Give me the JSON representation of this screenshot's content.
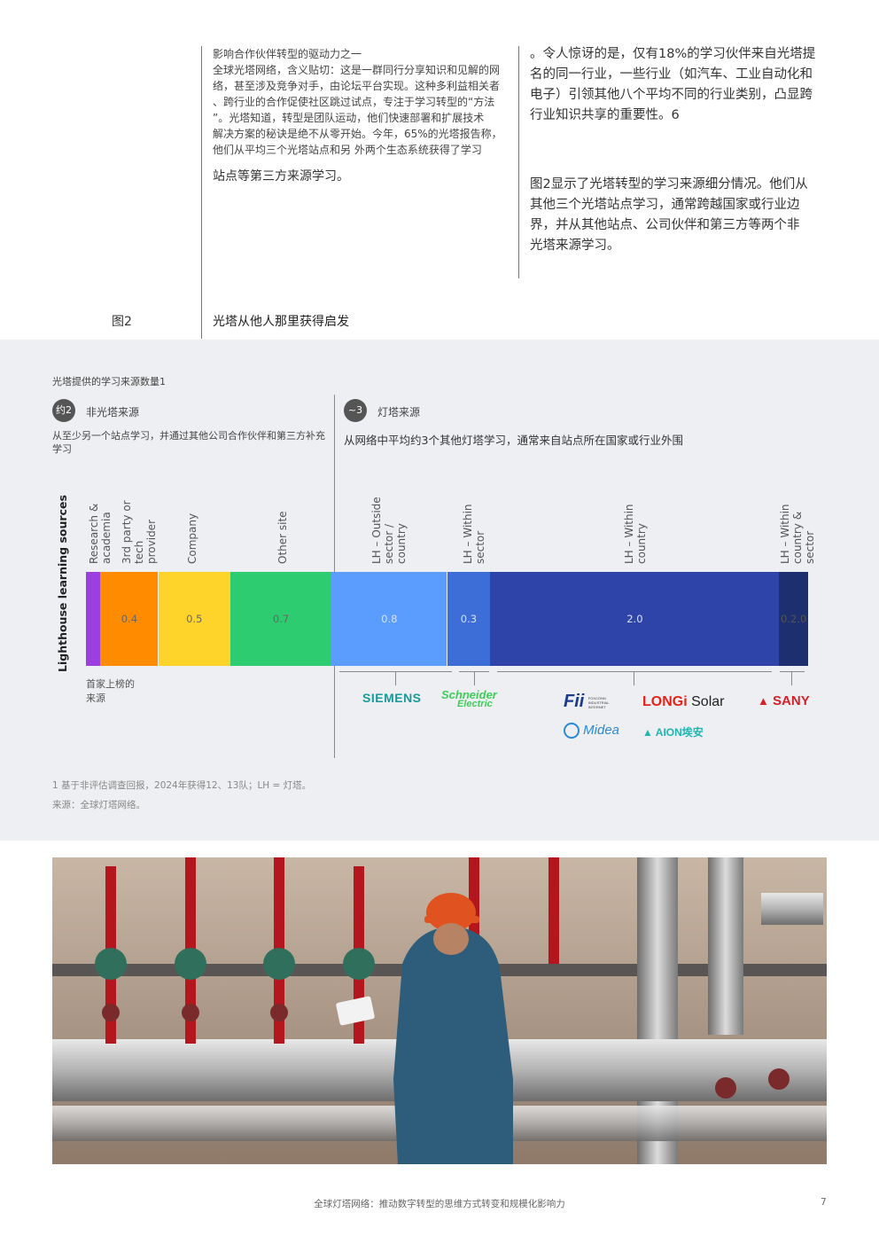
{
  "text": {
    "left_col": {
      "heading": "影响合作伙伴转型的驱动力之一",
      "line1": "全球光塔网络，含义贴切：这是一群同行分享知识和见解的网",
      "line2": "络，甚至涉及竞争对手，由论坛平台实现。这种多利益相关者",
      "line3": "、跨行业的合作促使社区跳过试点，专注于学习转型的“方法",
      "line4": "”。光塔知道，转型是团队运动，他们快速部署和扩展技术",
      "line5": "解决方案的秘诀是绝不从零开始。今年，65%的光塔报告称，",
      "line6": "他们从平均三个光塔站点和另 外两个生态系统获得了学习",
      "line7": "站点等第三方来源学习。"
    },
    "right_col": {
      "line1": "。令人惊讶的是，仅有18%的学习伙伴来自光塔提",
      "line2": "名的同一行业，一些行业（如汽车、工业自动化和",
      "line3": "电子）引领其他八个平均不同的行业类别，凸显跨",
      "line4": "行业知识共享的重要性。6",
      "line5": "图2显示了光塔转型的学习来源细分情况。他们从",
      "line6": "其他三个光塔站点学习，通常跨越国家或行业边",
      "line7": "界，并从其他站点、公司伙伴和第三方等两个非",
      "line8": "光塔来源学习。"
    },
    "figure_label": "图2",
    "figure_title": "光塔从他人那里获得启发",
    "chart_heading": "光塔提供的学习来源数量1",
    "left_group": {
      "badge": "约2",
      "title": "非光塔来源",
      "desc1": "从至少另一个站点学习，并通过其他公司合作伙伴和第三方补充",
      "desc2": "学习"
    },
    "right_group": {
      "badge": "~3",
      "title": "灯塔来源",
      "desc": "从网络中平均约3个其他灯塔学习，通常来自站点所在国家或行业外围"
    },
    "y_axis_label": "Lighthouse learning sources",
    "first_listed": "首家上榜的\n来源",
    "footnote": "1   基于非评估调查回报，2024年获得12、13队；LH = 灯塔。",
    "source": "来源：全球灯塔网络。",
    "footer": "全球灯塔网络：推动数字转型的思维方式转变和规模化影响力",
    "page_number": "7"
  },
  "logos": {
    "siemens": "SIEMENS",
    "schneider_1": "Schneider",
    "schneider_2": "Electric",
    "fii": "Fii",
    "fii_sub": "FOXCONN INDUSTRIAL INTERNET",
    "longi_1": "LONGi",
    "longi_2": "Solar",
    "sany": "SANY",
    "midea": "Midea",
    "aion": "AION埃安"
  },
  "chart_data": {
    "type": "bar",
    "orientation": "horizontal-stacked",
    "categories": [
      "Research & academia",
      "3rd party or tech provider",
      "Company",
      "Other site",
      "LH – Outside sector / country",
      "LH – Within sector",
      "LH – Within country",
      "LH – Within country & sector"
    ],
    "values": [
      0.1,
      0.4,
      0.5,
      0.7,
      0.8,
      0.3,
      2.0,
      0.2
    ],
    "value_labels": [
      "",
      "0.4",
      "0.5",
      "0.7",
      "0.8",
      "0.3",
      "2.0",
      "0.2.0"
    ],
    "colors": [
      "#9b3fe0",
      "#ff8c00",
      "#ffd42a",
      "#2ecc71",
      "#5b9cff",
      "#3d6dd6",
      "#2e44a8",
      "#1d2f6e"
    ],
    "ylabel": "Lighthouse learning sources"
  }
}
